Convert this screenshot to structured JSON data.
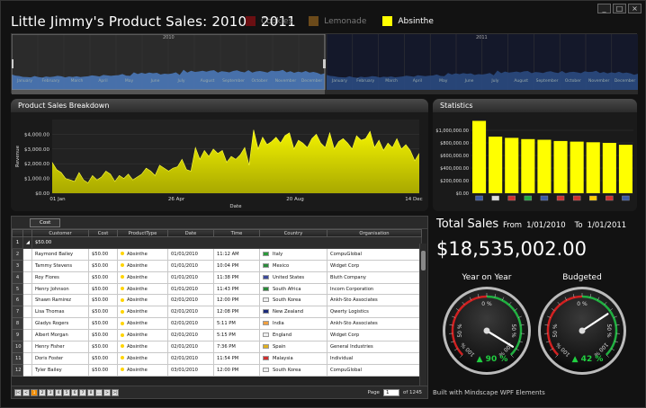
{
  "window": {
    "controls": [
      "_",
      "□",
      "×"
    ]
  },
  "app_title": "Little Jimmy's Product Sales: 2010 - 2011",
  "legend": [
    {
      "label": "Cookies",
      "color": "#6b0f12",
      "text_color": "#7a7a7a"
    },
    {
      "label": "Lemonade",
      "color": "#6b4a1a",
      "text_color": "#7a7a7a"
    },
    {
      "label": "Absinthe",
      "color": "#ffff00",
      "text_color": "#ffffff"
    }
  ],
  "overview": {
    "years": [
      "2010",
      "2011"
    ],
    "months_2010": [
      "January",
      "February",
      "March",
      "April",
      "May",
      "June",
      "July",
      "August",
      "September",
      "October",
      "November",
      "December"
    ],
    "months_2011": [
      "January",
      "February",
      "March",
      "April",
      "May",
      "June",
      "July",
      "August",
      "September",
      "October",
      "November",
      "December"
    ],
    "selection_label": "|||"
  },
  "breakdown": {
    "title": "Product Sales Breakdown",
    "chart_data": {
      "type": "area",
      "title": "",
      "xlabel": "Date",
      "ylabel": "Revenue",
      "ylim": [
        0,
        5000
      ],
      "yticks": [
        "$0.00",
        "$1,000.00",
        "$2,000.00",
        "$3,000.00",
        "$4,000.00"
      ],
      "xticks": [
        "01 Jan",
        "26 Apr",
        "20 Aug",
        "14 Dec"
      ],
      "series": [
        {
          "name": "Absinthe",
          "color": "#e8e800",
          "values": [
            2100,
            1600,
            1400,
            1000,
            900,
            800,
            1400,
            900,
            700,
            1200,
            900,
            1100,
            1500,
            1300,
            800,
            1200,
            1000,
            1300,
            900,
            1100,
            1300,
            1700,
            1500,
            1200,
            1900,
            1700,
            1500,
            1700,
            1800,
            2300,
            1600,
            1500,
            3100,
            2300,
            2900,
            2500,
            3000,
            2700,
            2900,
            2100,
            2500,
            2300,
            2600,
            3100,
            1900,
            4300,
            3000,
            3800,
            3300,
            3500,
            3800,
            3400,
            3900,
            4100,
            3000,
            3600,
            3400,
            3100,
            3700,
            4000,
            3400,
            3100,
            4100,
            3000,
            3500,
            3700,
            3400,
            3000,
            3900,
            3600,
            3700,
            4200,
            3100,
            3600,
            2900,
            3400,
            3100,
            3700,
            3000,
            3300,
            2900,
            2200,
            2700
          ]
        }
      ]
    }
  },
  "statistics": {
    "title": "Statistics",
    "chart_data": {
      "type": "bar",
      "categories": [
        "flag-1",
        "flag-2",
        "flag-3",
        "flag-4",
        "flag-5",
        "flag-6",
        "flag-7",
        "flag-8",
        "flag-9",
        "flag-10"
      ],
      "values": [
        1150000,
        900000,
        880000,
        860000,
        850000,
        830000,
        820000,
        810000,
        800000,
        770000
      ],
      "ylim": [
        0,
        1200000
      ],
      "yticks": [
        "$0.00",
        "$200,000.00",
        "$400,000.00",
        "$600,000.00",
        "$800,000.00",
        "$1,000,000.00"
      ],
      "flag_colors": [
        "#3c5aa8",
        "#dddddd",
        "#d03030",
        "#22aa44",
        "#3c5aa8",
        "#d03030",
        "#d03030",
        "#ffcc00",
        "#d03030",
        "#3c5aa8"
      ]
    },
    "total_label": "Total Sales",
    "from_label": "From",
    "from_date": "1/01/2010",
    "to_label": "To",
    "to_date": "1/01/2011",
    "total_value": "$18,535,002.00",
    "gauges": [
      {
        "label": "Year on Year",
        "value": 90,
        "display": "▲ 90 %"
      },
      {
        "label": "Budgeted",
        "value": 42,
        "display": "▲ 42 %"
      }
    ],
    "gauge_ticks": [
      "0 %",
      "50 %",
      "100 %",
      "50 %",
      "100 %"
    ]
  },
  "grid": {
    "group_button": "Cost",
    "columns": [
      "Customer",
      "Cost",
      "ProductType",
      "Date",
      "Time",
      "Country",
      "Organisation"
    ],
    "group_row": {
      "num": "1",
      "label": "$50.00"
    },
    "rows": [
      {
        "num": "2",
        "customer": "Raymond Bailey",
        "cost": "$50.00",
        "product": "Absinthe",
        "date": "01/01/2010",
        "time": "11:12 AM",
        "country": "Italy",
        "flag": "#2a9a3a",
        "org": "CompuGlobal"
      },
      {
        "num": "3",
        "customer": "Tammy Stevens",
        "cost": "$50.00",
        "product": "Absinthe",
        "date": "01/01/2010",
        "time": "10:04 PM",
        "country": "Mexico",
        "flag": "#2a8a3a",
        "org": "Widget Corp"
      },
      {
        "num": "4",
        "customer": "Roy Flores",
        "cost": "$50.00",
        "product": "Absinthe",
        "date": "01/01/2010",
        "time": "11:38 PM",
        "country": "United States",
        "flag": "#3c4a9a",
        "org": "Bluth Company"
      },
      {
        "num": "5",
        "customer": "Henry Johnson",
        "cost": "$50.00",
        "product": "Absinthe",
        "date": "01/01/2010",
        "time": "11:43 PM",
        "country": "South Africa",
        "flag": "#2a8a3a",
        "org": "Incom Corporation"
      },
      {
        "num": "6",
        "customer": "Shawn Ramirez",
        "cost": "$50.00",
        "product": "Absinthe",
        "date": "02/01/2010",
        "time": "12:00 PM",
        "country": "South Korea",
        "flag": "#eeeeee",
        "org": "Ankh-Sto Associates"
      },
      {
        "num": "7",
        "customer": "Lisa Thomas",
        "cost": "$50.00",
        "product": "Absinthe",
        "date": "02/01/2010",
        "time": "12:08 PM",
        "country": "New Zealand",
        "flag": "#1a2a7a",
        "org": "Qwerty Logistics"
      },
      {
        "num": "8",
        "customer": "Gladys Rogers",
        "cost": "$50.00",
        "product": "Absinthe",
        "date": "02/01/2010",
        "time": "5:11 PM",
        "country": "India",
        "flag": "#f0a040",
        "org": "Ankh-Sto Associates"
      },
      {
        "num": "9",
        "customer": "Albert Morgan",
        "cost": "$50.00",
        "product": "Absinthe",
        "date": "02/01/2010",
        "time": "5:15 PM",
        "country": "England",
        "flag": "#eeeeee",
        "org": "Widget Corp"
      },
      {
        "num": "10",
        "customer": "Henry Fisher",
        "cost": "$50.00",
        "product": "Absinthe",
        "date": "02/01/2010",
        "time": "7:36 PM",
        "country": "Spain",
        "flag": "#e0b020",
        "org": "General Industries"
      },
      {
        "num": "11",
        "customer": "Doris Foster",
        "cost": "$50.00",
        "product": "Absinthe",
        "date": "02/01/2010",
        "time": "11:54 PM",
        "country": "Malaysia",
        "flag": "#d03030",
        "org": "Individual"
      },
      {
        "num": "12",
        "customer": "Tyler Bailey",
        "cost": "$50.00",
        "product": "Absinthe",
        "date": "03/01/2010",
        "time": "12:00 PM",
        "country": "South Korea",
        "flag": "#eeeeee",
        "org": "CompuGlobal"
      }
    ],
    "pager": {
      "first": "|<",
      "prev": "<",
      "pages": [
        "1",
        "2",
        "3",
        "4",
        "5",
        "6",
        "7",
        "8"
      ],
      "more": "...",
      "next": ">",
      "last": ">|",
      "page_label": "Page",
      "page_value": "1",
      "of_label": "of 1245"
    }
  },
  "footer": "Built with Mindscape WPF Elements"
}
